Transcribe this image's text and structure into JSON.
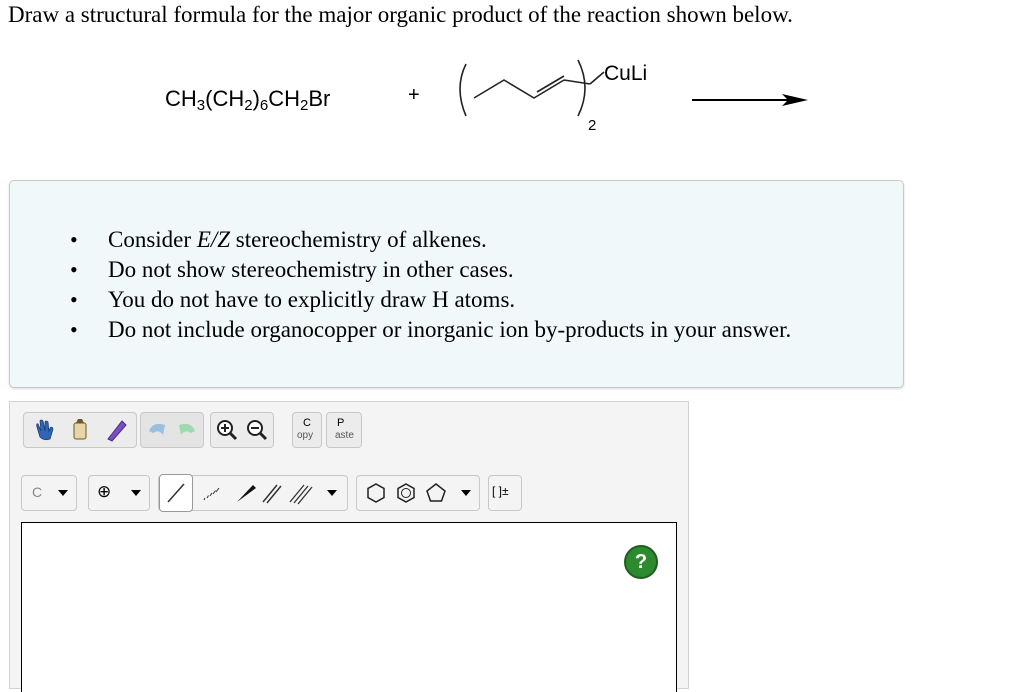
{
  "question": "Draw a structural formula for the major organic product of the reaction shown below.",
  "reaction": {
    "reagent1": {
      "part1": "CH",
      "sub1": "3",
      "part2": "(CH",
      "sub2": "2",
      "part3": ")",
      "sub3": "6",
      "part4": "CH",
      "sub4": "2",
      "part5": "Br"
    },
    "plus": "+",
    "reagent2_label": "CuLi",
    "reagent2_subscript": "2"
  },
  "hints": [
    {
      "before": "Consider ",
      "em": "E/Z",
      "after": " stereochemistry of alkenes."
    },
    {
      "before": "Do not show stereochemistry in other cases.",
      "em": "",
      "after": ""
    },
    {
      "before": "You do not have to explicitly draw H atoms.",
      "em": "",
      "after": ""
    },
    {
      "before": "Do not include organocopper or inorganic ion by-products in your answer.",
      "em": "",
      "after": ""
    }
  ],
  "toolbar": {
    "copy_label_top": "C",
    "copy_label_bottom": "opy",
    "paste_label_top": "P",
    "paste_label_bottom": "aste",
    "atom_selector": "C",
    "charge_symbol": "⊕",
    "bracket_label": "[ ]±"
  },
  "help_label": "?"
}
